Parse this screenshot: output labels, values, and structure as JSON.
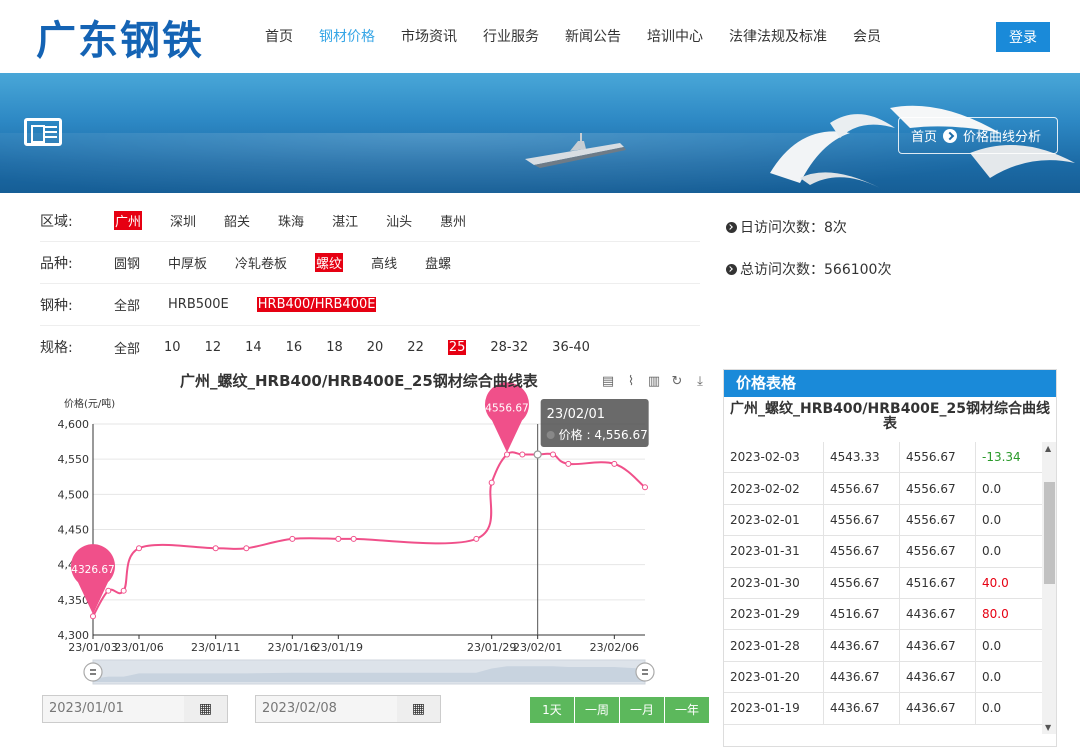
{
  "header": {
    "logo": "广东钢铁",
    "nav": [
      "首页",
      "钢材价格",
      "市场资讯",
      "行业服务",
      "新闻公告",
      "培训中心",
      "法律法规及标准",
      "会员"
    ],
    "active_nav": 1,
    "login": "登录"
  },
  "banner": {
    "crumb_home": "首页",
    "crumb_current": "价格曲线分析"
  },
  "filters": {
    "region": {
      "label": "区域:",
      "options": [
        "广州",
        "深圳",
        "韶关",
        "珠海",
        "湛江",
        "汕头",
        "惠州"
      ],
      "selected": 0
    },
    "product": {
      "label": "品种:",
      "options": [
        "圆钢",
        "中厚板",
        "冷轧卷板",
        "螺纹",
        "高线",
        "盘螺"
      ],
      "selected": 3
    },
    "grade": {
      "label": "钢种:",
      "options": [
        "全部",
        "HRB500E",
        "HRB400/HRB400E"
      ],
      "selected": 2
    },
    "size": {
      "label": "规格:",
      "options": [
        "全部",
        "10",
        "12",
        "14",
        "16",
        "18",
        "20",
        "22",
        "25",
        "28-32",
        "36-40"
      ],
      "selected": 8
    }
  },
  "stats": {
    "daily": "日访问次数：8次",
    "total": "总访问次数：566100次"
  },
  "chart": {
    "title": "广州_螺纹_HRB400/HRB400E_25钢材综合曲线表",
    "tooltip_date": "23/02/01",
    "tooltip_value": "价格 : 4,556.67",
    "min_pin": "4326.67",
    "max_pin": "4556.67",
    "line_color": "#f0508a"
  },
  "chart_data": {
    "type": "line",
    "ylabel": "价格(元/吨)",
    "ylim": [
      4300,
      4600
    ],
    "yticks": [
      "4,300",
      "4,350",
      "4,400",
      "4,450",
      "4,500",
      "4,550",
      "4,600"
    ],
    "xticks": [
      "23/01/03",
      "23/01/06",
      "23/01/11",
      "23/01/16",
      "23/01/19",
      "23/01/29",
      "23/02/01",
      "23/02/06"
    ],
    "series": [
      {
        "values": [
          {
            "x": "23/01/03",
            "y": 4326.67
          },
          {
            "x": "23/01/04",
            "y": 4363
          },
          {
            "x": "23/01/05",
            "y": 4363
          },
          {
            "x": "23/01/06",
            "y": 4423.33
          },
          {
            "x": "23/01/11",
            "y": 4423.33
          },
          {
            "x": "23/01/13",
            "y": 4423.33
          },
          {
            "x": "23/01/16",
            "y": 4436.67
          },
          {
            "x": "23/01/19",
            "y": 4436.67
          },
          {
            "x": "23/01/20",
            "y": 4436.67
          },
          {
            "x": "23/01/28",
            "y": 4436.67
          },
          {
            "x": "23/01/29",
            "y": 4516.67
          },
          {
            "x": "23/01/30",
            "y": 4556.67
          },
          {
            "x": "23/01/31",
            "y": 4556.67
          },
          {
            "x": "23/02/01",
            "y": 4556.67
          },
          {
            "x": "23/02/02",
            "y": 4556.67
          },
          {
            "x": "23/02/03",
            "y": 4543.33
          },
          {
            "x": "23/02/06",
            "y": 4543.33
          },
          {
            "x": "23/02/08",
            "y": 4510
          }
        ]
      }
    ]
  },
  "controls": {
    "start_date": "2023/01/01",
    "end_date": "2023/02/08",
    "ranges": [
      "1天",
      "一周",
      "一月",
      "一年"
    ]
  },
  "table": {
    "header": "价格表格",
    "title": "广州_螺纹_HRB400/HRB400E_25钢材综合曲线表",
    "rows": [
      {
        "date": "2023-02-03",
        "a": "4543.33",
        "b": "4556.67",
        "chg": "-13.34",
        "dir": "down"
      },
      {
        "date": "2023-02-02",
        "a": "4556.67",
        "b": "4556.67",
        "chg": "0.0",
        "dir": "flat"
      },
      {
        "date": "2023-02-01",
        "a": "4556.67",
        "b": "4556.67",
        "chg": "0.0",
        "dir": "flat"
      },
      {
        "date": "2023-01-31",
        "a": "4556.67",
        "b": "4556.67",
        "chg": "0.0",
        "dir": "flat"
      },
      {
        "date": "2023-01-30",
        "a": "4556.67",
        "b": "4516.67",
        "chg": "40.0",
        "dir": "up"
      },
      {
        "date": "2023-01-29",
        "a": "4516.67",
        "b": "4436.67",
        "chg": "80.0",
        "dir": "up"
      },
      {
        "date": "2023-01-28",
        "a": "4436.67",
        "b": "4436.67",
        "chg": "0.0",
        "dir": "flat"
      },
      {
        "date": "2023-01-20",
        "a": "4436.67",
        "b": "4436.67",
        "chg": "0.0",
        "dir": "flat"
      },
      {
        "date": "2023-01-19",
        "a": "4436.67",
        "b": "4436.67",
        "chg": "0.0",
        "dir": "flat"
      }
    ]
  }
}
